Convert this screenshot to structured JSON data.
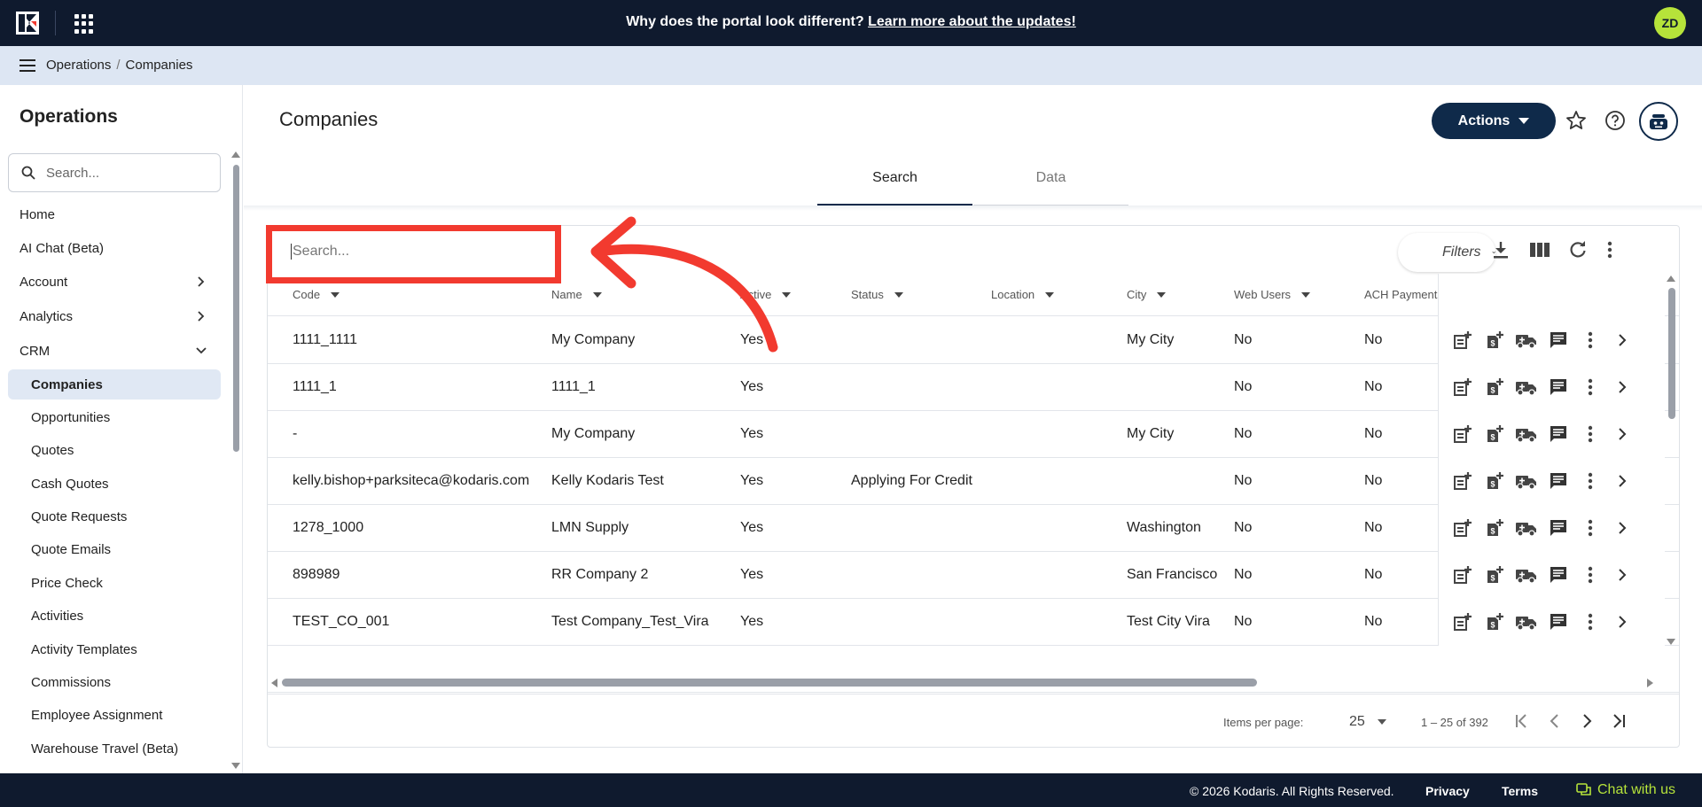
{
  "announcement": {
    "text": "Why does the portal look different?",
    "link": "Learn more about the updates!"
  },
  "user": {
    "initials": "ZD"
  },
  "breadcrumb": {
    "parent": "Operations",
    "current": "Companies"
  },
  "sidebar": {
    "title": "Operations",
    "search_placeholder": "Search...",
    "items": [
      {
        "label": "Home"
      },
      {
        "label": "AI Chat (Beta)"
      },
      {
        "label": "Account"
      },
      {
        "label": "Analytics"
      },
      {
        "label": "CRM"
      }
    ],
    "crm_items": [
      {
        "label": "Companies"
      },
      {
        "label": "Opportunities"
      },
      {
        "label": "Quotes"
      },
      {
        "label": "Cash Quotes"
      },
      {
        "label": "Quote Requests"
      },
      {
        "label": "Quote Emails"
      },
      {
        "label": "Price Check"
      },
      {
        "label": "Activities"
      },
      {
        "label": "Activity Templates"
      },
      {
        "label": "Commissions"
      },
      {
        "label": "Employee Assignment"
      },
      {
        "label": "Warehouse Travel (Beta)"
      }
    ]
  },
  "page": {
    "title": "Companies",
    "actions_label": "Actions",
    "tabs": [
      {
        "label": "Search"
      },
      {
        "label": "Data"
      }
    ]
  },
  "table": {
    "search_placeholder": "Search...",
    "filters_label": "Filters",
    "columns": [
      "Code",
      "Name",
      "Active",
      "Status",
      "Location",
      "City",
      "Web Users",
      "ACH Payments"
    ],
    "rows": [
      {
        "code": "1111_1111",
        "name": "My Company",
        "active": "Yes",
        "status": "",
        "location": "",
        "city": "My City",
        "web_users": "No",
        "ach": "No"
      },
      {
        "code": "1111_1",
        "name": "1111_1",
        "active": "Yes",
        "status": "",
        "location": "",
        "city": "",
        "web_users": "No",
        "ach": "No"
      },
      {
        "code": "-",
        "name": "My Company",
        "active": "Yes",
        "status": "",
        "location": "",
        "city": "My City",
        "web_users": "No",
        "ach": "No"
      },
      {
        "code": "kelly.bishop+parksiteca@kodaris.com",
        "name": "Kelly Kodaris Test",
        "active": "Yes",
        "status": "Applying For Credit",
        "location": "",
        "city": "",
        "web_users": "No",
        "ach": "No"
      },
      {
        "code": "1278_1000",
        "name": "LMN Supply",
        "active": "Yes",
        "status": "",
        "location": "",
        "city": "Washington",
        "web_users": "No",
        "ach": "No"
      },
      {
        "code": "898989",
        "name": "RR Company 2",
        "active": "Yes",
        "status": "",
        "location": "",
        "city": "San Francisco",
        "web_users": "No",
        "ach": "No"
      },
      {
        "code": "TEST_CO_001",
        "name": "Test Company_Test_Vira",
        "active": "Yes",
        "status": "",
        "location": "",
        "city": "Test City Vira",
        "web_users": "No",
        "ach": "No"
      }
    ],
    "paginator": {
      "items_per_page_label": "Items per page:",
      "page_size": "25",
      "range": "1 – 25 of 392"
    }
  },
  "footer": {
    "copyright": "© 2026 Kodaris. All Rights Reserved.",
    "privacy": "Privacy",
    "terms": "Terms",
    "chat": "Chat with us"
  },
  "colors": {
    "navy": "#0f1a2e",
    "accent": "#0f2a4a",
    "lime": "#b6e33a",
    "annotation_red": "#f23a2f"
  }
}
